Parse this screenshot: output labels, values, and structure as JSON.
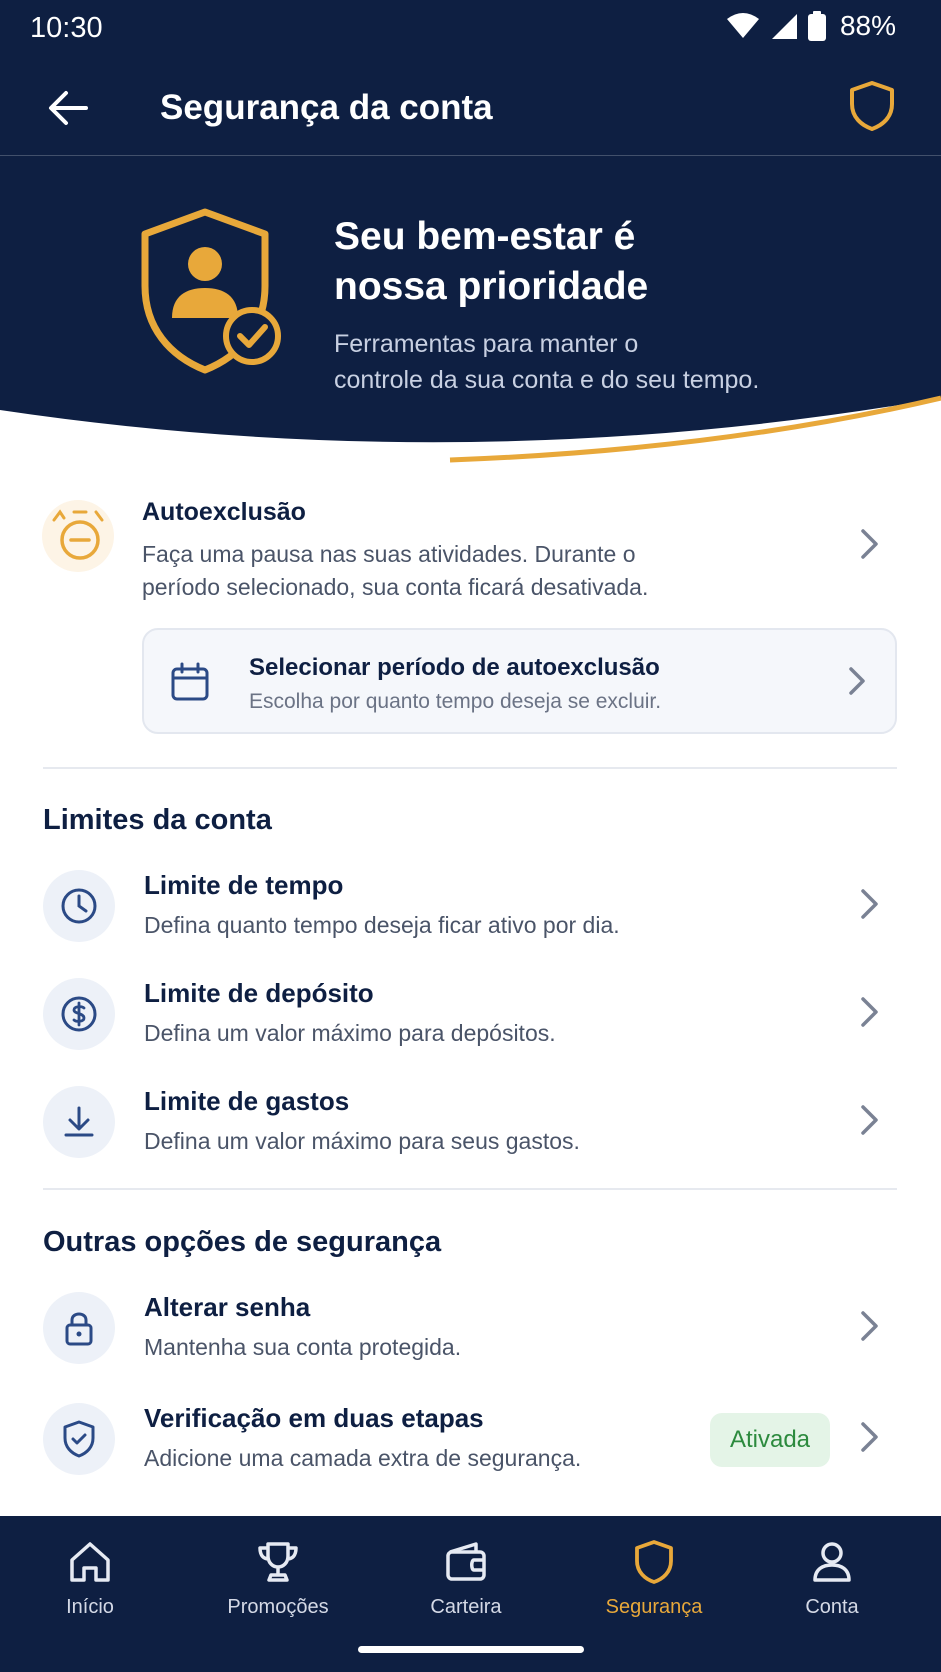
{
  "status_bar": {
    "time": "10:30",
    "battery": "88%"
  },
  "appbar": {
    "title": "Segurança da conta"
  },
  "hero": {
    "title_line1": "Seu bem-estar é",
    "title_line2": "nossa prioridade",
    "subtitle_line1": "Ferramentas para manter o",
    "subtitle_line2": "controle da sua conta e do seu tempo."
  },
  "autoexclusao": {
    "title": "Autoexclusão",
    "desc_line1": "Faça uma pausa nas suas atividades. Durante o",
    "desc_line2": "período selecionado, sua conta ficará desativada.",
    "card_title": "Selecionar período de autoexclusão",
    "card_desc": "Escolha por quanto tempo deseja se excluir."
  },
  "limits": {
    "section_title": "Limites da conta",
    "items": [
      {
        "title": "Limite de tempo",
        "desc": "Defina quanto tempo deseja ficar ativo por dia."
      },
      {
        "title": "Limite de depósito",
        "desc": "Defina um valor máximo para depósitos."
      },
      {
        "title": "Limite de gastos",
        "desc": "Defina um valor máximo para seus gastos."
      }
    ]
  },
  "security": {
    "section_title": "Outras opções de segurança",
    "items": [
      {
        "title": "Alterar senha",
        "desc": "Mantenha sua conta protegida."
      },
      {
        "title": "Verificação em duas etapas",
        "desc": "Adicione uma camada extra de segurança.",
        "badge": "Ativada"
      }
    ]
  },
  "nav": {
    "items": [
      {
        "label": "Início",
        "icon": "home-icon"
      },
      {
        "label": "Promoções",
        "icon": "trophy-icon"
      },
      {
        "label": "Carteira",
        "icon": "wallet-icon"
      },
      {
        "label": "Segurança",
        "icon": "shield-icon"
      },
      {
        "label": "Conta",
        "icon": "user-icon"
      }
    ],
    "active": "Segurança"
  },
  "colors": {
    "navy": "#0e1f42",
    "gold": "#e8a83a",
    "success": "#2c8a3e"
  }
}
